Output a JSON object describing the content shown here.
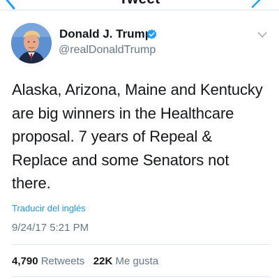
{
  "header": {
    "title": "Tweet",
    "back_icon": "chevron-left-icon",
    "compose_icon": "compose-icon",
    "accent_color": "#1da1f2"
  },
  "tweet": {
    "author": {
      "display_name": "Donald J. Trump",
      "handle": "@realDonaldTrump",
      "verified": true,
      "avatar_icon": "avatar"
    },
    "text": "Alaska, Arizona, Maine and Kentucky are big winners in the Healthcare proposal. 7 years of Repeal & Replace and some Senators not there.",
    "translate_label": "Traducir del inglés",
    "timestamp": "9/24/17 5:21 PM",
    "stats": {
      "retweets_count": "4,790",
      "retweets_label": "Retweets",
      "likes_count": "22K",
      "likes_label": "Me gusta"
    }
  },
  "colors": {
    "link": "#1b95e0",
    "muted": "#657786",
    "text": "#14171a",
    "verified": "#1da1f2"
  }
}
